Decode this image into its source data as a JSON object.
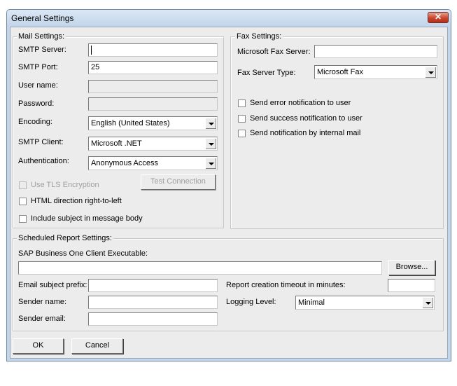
{
  "window": {
    "title": "General Settings",
    "close_glyph": "✕"
  },
  "mail": {
    "group_label": "Mail Settings:",
    "smtp_server_label": "SMTP Server:",
    "smtp_server_value": "",
    "smtp_port_label": "SMTP Port:",
    "smtp_port_value": "25",
    "username_label": "User name:",
    "username_value": "",
    "password_label": "Password:",
    "password_value": "",
    "encoding_label": "Encoding:",
    "encoding_value": "English (United States)",
    "smtp_client_label": "SMTP Client:",
    "smtp_client_value": "Microsoft .NET",
    "auth_label": "Authentication:",
    "auth_value": "Anonymous Access",
    "tls_label": "Use TLS Encryption",
    "test_button": "Test Connection",
    "html_rtl_label": "HTML direction right-to-left",
    "include_subject_label": "Include subject in message body"
  },
  "fax": {
    "group_label": "Fax Settings:",
    "server_label": "Microsoft Fax Server:",
    "server_value": "",
    "type_label": "Fax Server Type:",
    "type_value": "Microsoft Fax",
    "error_notif_label": "Send error notification to user",
    "success_notif_label": "Send success notification to user",
    "internal_mail_label": "Send notification by internal mail"
  },
  "scheduled": {
    "group_label": "Scheduled Report Settings:",
    "exe_label": "SAP Business One Client Executable:",
    "exe_value": "",
    "browse_button": "Browse...",
    "subject_prefix_label": "Email subject prefix:",
    "subject_prefix_value": "",
    "timeout_label": "Report creation timeout in minutes:",
    "timeout_value": "",
    "sender_name_label": "Sender name:",
    "sender_name_value": "",
    "logging_label": "Logging Level:",
    "logging_value": "Minimal",
    "sender_email_label": "Sender email:",
    "sender_email_value": ""
  },
  "footer": {
    "ok_button": "OK",
    "cancel_button": "Cancel"
  }
}
